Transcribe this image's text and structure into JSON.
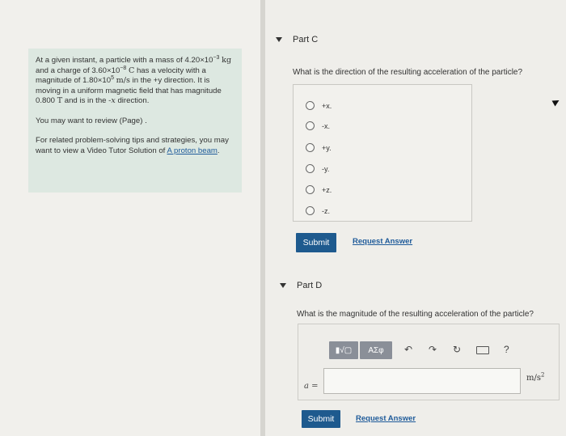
{
  "problem": {
    "line1": "At a given instant, a particle with a mass of",
    "mass_value": "4.20×10",
    "mass_exp": "−3",
    "mass_unit": "kg",
    "charge_text": "and a charge of 3.60×10",
    "charge_exp": "−8",
    "charge_unit": "C",
    "charge_tail": "has a",
    "velocity_text": "velocity with a magnitude of 1.80×10",
    "velocity_exp": "5",
    "velocity_unit": "m/s",
    "velocity_tail": "in the",
    "direction_text": "+y direction. It is moving in a uniform magnetic field",
    "field_text": "that has magnitude 0.800",
    "field_unit": "T",
    "field_tail": "and is in the -",
    "field_axis": "x",
    "direction_word": "direction.",
    "review": "You may want to review (Page) .",
    "tips": "For related problem-solving tips and strategies, you may want to view a Video Tutor Solution of",
    "tips_link": "A proton beam",
    "tips_end": "."
  },
  "partC": {
    "title": "Part C",
    "question": "What is the direction of the resulting acceleration of the particle?",
    "options": [
      "+x.",
      "-x.",
      "+y.",
      "-y.",
      "+z.",
      "-z."
    ],
    "submit": "Submit",
    "request": "Request Answer"
  },
  "partD": {
    "title": "Part D",
    "question": "What is the magnitude of the resulting acceleration of the particle?",
    "toolbar": {
      "templates": "▮√▢",
      "symbols": "ΑΣφ",
      "help": "?"
    },
    "variable": "a =",
    "unit_base": "m/s",
    "unit_exp": "2",
    "submit": "Submit",
    "request": "Request Answer"
  },
  "colors": {
    "accent": "#1e5a8e",
    "problem_bg": "#dde8e1",
    "link": "#1f5b9a"
  },
  "icons": [
    "triangle-down-icon",
    "radio-icon",
    "undo-icon",
    "redo-icon",
    "reset-icon",
    "keyboard-icon",
    "cursor-icon"
  ]
}
